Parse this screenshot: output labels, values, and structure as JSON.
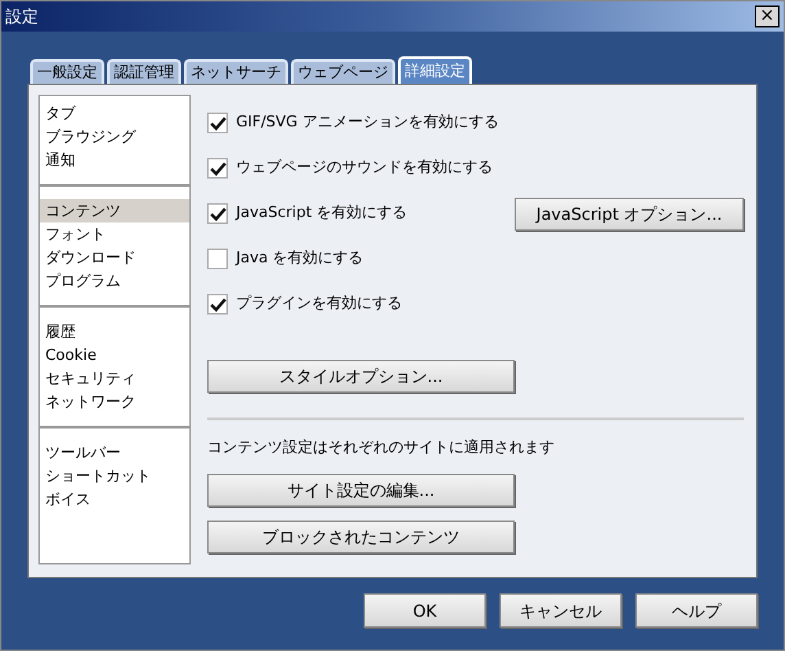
{
  "window": {
    "title": "設定",
    "close": "×"
  },
  "tabs": [
    {
      "label": "一般設定",
      "selected": false
    },
    {
      "label": "認証管理",
      "selected": false
    },
    {
      "label": "ネットサーチ",
      "selected": false
    },
    {
      "label": "ウェブページ",
      "selected": false
    },
    {
      "label": "詳細設定",
      "selected": true
    }
  ],
  "sidebar": {
    "groups": [
      {
        "items": [
          {
            "label": "タブ",
            "selected": false
          },
          {
            "label": "ブラウジング",
            "selected": false
          },
          {
            "label": "通知",
            "selected": false
          }
        ]
      },
      {
        "items": [
          {
            "label": "コンテンツ",
            "selected": true
          },
          {
            "label": "フォント",
            "selected": false
          },
          {
            "label": "ダウンロード",
            "selected": false
          },
          {
            "label": "プログラム",
            "selected": false
          }
        ]
      },
      {
        "items": [
          {
            "label": "履歴",
            "selected": false
          },
          {
            "label": "Cookie",
            "selected": false
          },
          {
            "label": "セキュリティ",
            "selected": false
          },
          {
            "label": "ネットワーク",
            "selected": false
          }
        ]
      },
      {
        "items": [
          {
            "label": "ツールバー",
            "selected": false
          },
          {
            "label": "ショートカット",
            "selected": false
          },
          {
            "label": "ボイス",
            "selected": false
          }
        ]
      }
    ]
  },
  "options": [
    {
      "label": "GIF/SVG アニメーションを有効にする",
      "checked": true
    },
    {
      "label": "ウェブページのサウンドを有効にする",
      "checked": true
    },
    {
      "label": "JavaScript を有効にする",
      "checked": true,
      "button": "JavaScript オプション..."
    },
    {
      "label": "Java を有効にする",
      "checked": false
    },
    {
      "label": "プラグインを有効にする",
      "checked": true
    }
  ],
  "style_button": "スタイルオプション...",
  "site_note": "コンテンツ設定はそれぞれのサイトに適用されます",
  "site_buttons": [
    "サイト設定の編集...",
    "ブロックされたコンテンツ"
  ],
  "buttons": [
    "OK",
    "キャンセル",
    "ヘルプ"
  ]
}
